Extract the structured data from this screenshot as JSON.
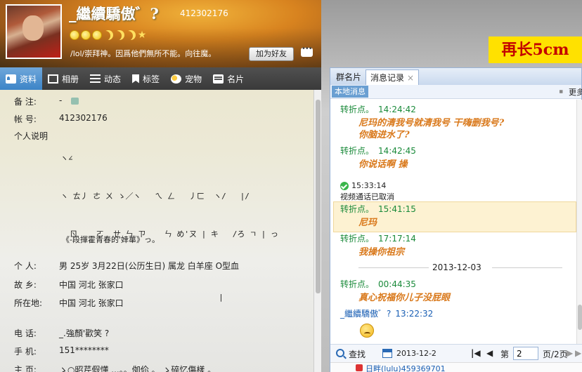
{
  "profile": {
    "nickname": "_繼續驕傲゛?",
    "qq_header": "412302176",
    "motto": "/lol/崇拜神。因爲他們無所不能。向往魔。",
    "add_friend": "加为好友"
  },
  "tabs": [
    {
      "label": "资料",
      "icon": "id-card-icon"
    },
    {
      "label": "相册",
      "icon": "photo-icon"
    },
    {
      "label": "动态",
      "icon": "feed-list-icon"
    },
    {
      "label": "标签",
      "icon": "bookmark-icon"
    },
    {
      "label": "宠物",
      "icon": "pet-icon"
    },
    {
      "label": "名片",
      "icon": "namecard-icon"
    }
  ],
  "fields": {
    "remark": {
      "label": "备    注:",
      "value": "-"
    },
    "account": {
      "label": "帐    号:",
      "value": "412302176"
    },
    "signature": {
      "label": "个人说明",
      "lines": [
        "ヽ∠",
        "ヽ ㄊ丿 ㄜ ㄨ ゝ／ヽ   ㄟ ㄥ   丿ㄈ  ヽ/   |/",
        "  ㄖ    ㄛ  ㄝ ㄣ ㄗ    ㄣ め'ㄡ | キ   /ろ ㄱ | っ",
        "",
        "                                  |"
      ]
    },
    "poem": "《-段揮霍青春的'婞蕐》っ。",
    "personal": {
      "label": "个    人:",
      "value": "男   25岁   3月22日(公历生日)   属龙   白羊座   O型血"
    },
    "hometown": {
      "label": "故    乡:",
      "value": "中国 河北 张家口"
    },
    "location": {
      "label": "所在地:",
      "value": "中国 河北 张家口"
    },
    "phone": {
      "label": "电    话:",
      "value": "_.強顏'歡笑 ?"
    },
    "mobile": {
      "label": "手    机:",
      "value": "151********"
    },
    "homepage": {
      "label": "主    页:",
      "value": "ゝ○昭芹假懂 ...。。侞伱 。 ゝ碎忆傷樣 。"
    }
  },
  "chat": {
    "banner": "再长5cm",
    "tabs": [
      {
        "label": "群名片"
      },
      {
        "label": "消息记录"
      }
    ],
    "close": "×",
    "local_btn": "本地消息",
    "more": "更多",
    "messages": [
      {
        "sender": "转折点。",
        "time": "14:24:42",
        "text": [
          "尼玛的清我号就清我号 干嗨删我号?",
          "你脑进水了?"
        ]
      },
      {
        "sender": "转折点。",
        "time": "14:42:45",
        "text": [
          "你说话啊 操"
        ]
      },
      {
        "system_time": "15:33:14",
        "system_text": "视频通话已取消"
      },
      {
        "sender": "转折点。",
        "time": "15:41:15",
        "text": [
          "尼玛"
        ]
      },
      {
        "sender": "转折点。",
        "time": "17:17:14",
        "text": [
          "我操你祖宗"
        ]
      },
      {
        "date": "2013-12-03"
      },
      {
        "sender": "转折点。",
        "time": "00:44:35",
        "text": [
          "真心祝福你儿子没屁眼"
        ]
      },
      {
        "sender": "_繼續驕傲゛?",
        "time": "13:22:32",
        "self": true
      }
    ],
    "footer": {
      "find": "查找",
      "date": "2013-12-2",
      "page_prefix": "第",
      "page_value": "2",
      "page_total": "页/2页"
    },
    "bottom_peek": "日畔(lulu)459369701"
  },
  "colors": {
    "sender": "#1a8a3a",
    "message": "#d9781a",
    "self": "#1a5fb4",
    "banner_bg": "#ffe100",
    "banner_text": "#c30000"
  }
}
